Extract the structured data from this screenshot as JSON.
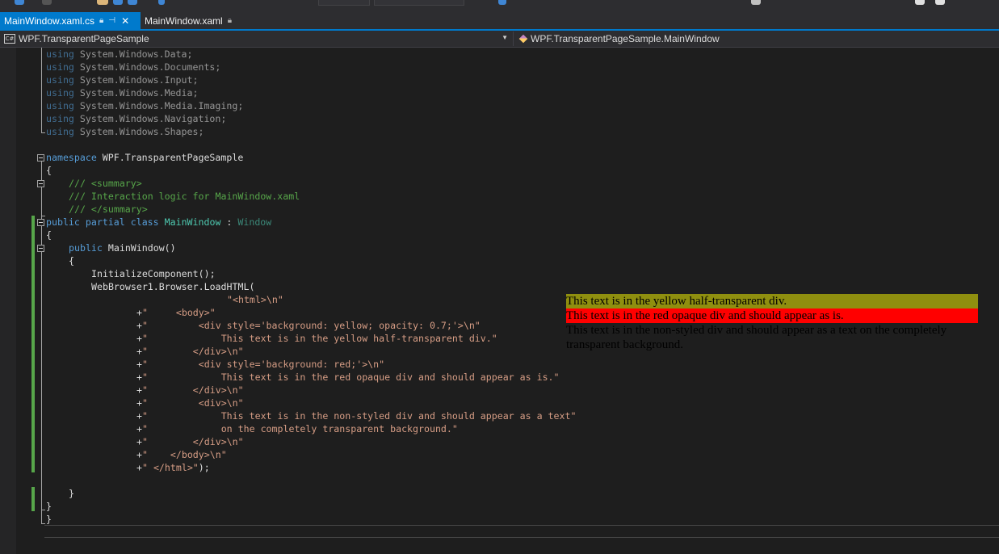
{
  "tabs": [
    {
      "label": "MainWindow.xaml.cs",
      "active": true
    },
    {
      "label": "MainWindow.xaml",
      "active": false
    }
  ],
  "navbar": {
    "project": "WPF.TransparentPageSample",
    "type_member": "WPF.TransparentPageSample.MainWindow"
  },
  "code": {
    "using_lines": [
      "System.Windows.Data;",
      "System.Windows.Documents;",
      "System.Windows.Input;",
      "System.Windows.Media;",
      "System.Windows.Media.Imaging;",
      "System.Windows.Navigation;",
      "System.Windows.Shapes;"
    ],
    "kw_using": "using",
    "kw_namespace": "namespace",
    "namespace_name": " WPF.TransparentPageSample",
    "open_brace": "{",
    "close_brace": "}",
    "summary_open": "/// <summary>",
    "summary_text": "/// Interaction logic for MainWindow.xaml",
    "summary_close": "/// </summary>",
    "kw_public": "public",
    "kw_partial": "partial",
    "kw_class": "class",
    "class_name": "MainWindow",
    "colon": " : ",
    "base_class": "Window",
    "ctor_name": "MainWindow()",
    "init_call": "InitializeComponent();",
    "load_call": "WebBrowser1.Browser.LoadHTML(",
    "html_lines": [
      {
        "pre": "",
        "str": "\"<html>\\n\""
      },
      {
        "pre": "+",
        "str": "\"     <body>\""
      },
      {
        "pre": "+",
        "str": "\"         <div style='background: yellow; opacity: 0.7;'>\\n\""
      },
      {
        "pre": "+",
        "str": "\"             This text is in the yellow half-transparent div.\""
      },
      {
        "pre": "+",
        "str": "\"        </div>\\n\""
      },
      {
        "pre": "+",
        "str": "\"         <div style='background: red;'>\\n\""
      },
      {
        "pre": "+",
        "str": "\"             This text is in the red opaque div and should appear as is.\""
      },
      {
        "pre": "+",
        "str": "\"        </div>\\n\""
      },
      {
        "pre": "+",
        "str": "\"         <div>\\n\""
      },
      {
        "pre": "+",
        "str": "\"             This text is in the non-styled div and should appear as a text\""
      },
      {
        "pre": "+",
        "str": "\"             on the completely transparent background.\""
      },
      {
        "pre": "+",
        "str": "\"        </div>\\n\""
      },
      {
        "pre": "+",
        "str": "\"    </body>\\n\""
      }
    ],
    "html_last_str": "\" </html>\"",
    "html_last_end": ");"
  },
  "preview": {
    "yellow_text": "This text is in the yellow half-transparent div.",
    "red_text": "This text is in the red opaque div and should appear as is.",
    "plain_text": "This text is in the non-styled div and should appear as a text on the completely transparent background."
  },
  "colors": {
    "accent": "#007acc",
    "keyword": "#569cd6",
    "type": "#4ec9b0",
    "string": "#d69d85",
    "comment": "#57a64a",
    "change_bar": "#57a64a"
  }
}
